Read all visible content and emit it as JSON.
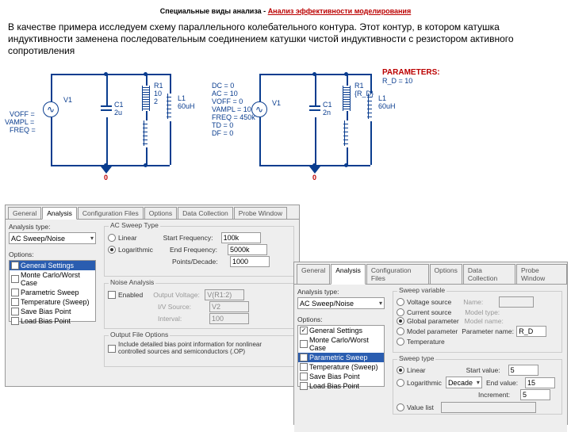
{
  "title_black": "Специальные виды анализа - ",
  "title_red": "Анализ эффективности моделирования",
  "desc": "В качестве примера исследуем схему параллельного колебательного контура. Этот контур, в котором катушка индуктивности заменена последовательным соединением катушки чистой индуктивности с резистором активного сопротивления",
  "sch1": {
    "v1": "V1",
    "voff": "VOFF =",
    "vampl": "VAMPL =",
    "freq": "FREQ =",
    "c1": "C1",
    "c1v": "2u",
    "r1": "R1",
    "r1v": "10",
    "r1v2": "2",
    "l1": "L1",
    "l1v": "60uH",
    "gnd": "0"
  },
  "sch2": {
    "v1": "V1",
    "dc": "DC = 0",
    "ac": "AC = 10",
    "voff": "VOFF = 0",
    "vampl": "VAMPL = 10",
    "freq": "FREQ = 450k",
    "td": "TD = 0",
    "df": "DF = 0",
    "c1": "C1",
    "c1v": "2n",
    "r1": "R1",
    "r1v": "{R_D}",
    "l1": "L1",
    "l1v": "60uH",
    "gnd": "0",
    "param": "PARAMETERS:",
    "param2": "R_D = 10"
  },
  "p1": {
    "tabs": [
      "General",
      "Analysis",
      "Configuration Files",
      "Options",
      "Data Collection",
      "Probe Window"
    ],
    "atype_lbl": "Analysis type:",
    "atype": "AC Sweep/Noise",
    "opt_lbl": "Options:",
    "opts": [
      "General Settings",
      "Monte Carlo/Worst Case",
      "Parametric Sweep",
      "Temperature (Sweep)",
      "Save Bias Point",
      "Load Bias Point"
    ],
    "sweep_hdr": "AC Sweep Type",
    "linear": "Linear",
    "log": "Logarithmic",
    "sf_lbl": "Start Frequency:",
    "sf": "100k",
    "ef_lbl": "End Frequency:",
    "ef": "5000k",
    "pd_lbl": "Points/Decade:",
    "pd": "1000",
    "noise_hdr": "Noise Analysis",
    "enabled": "Enabled",
    "ov_lbl": "Output Voltage:",
    "ov": "V(R1:2)",
    "iv_lbl": "I/V Source:",
    "iv": "V2",
    "int_lbl": "Interval:",
    "int": "100",
    "ofo_hdr": "Output File Options",
    "ofo": "Include detailed bias point information for nonlinear controlled sources and semiconductors (.OP)"
  },
  "p2": {
    "tabs": [
      "General",
      "Analysis",
      "Configuration Files",
      "Options",
      "Data Collection",
      "Probe Window"
    ],
    "atype_lbl": "Analysis type:",
    "atype": "AC Sweep/Noise",
    "opt_lbl": "Options:",
    "opts": [
      "General Settings",
      "Monte Carlo/Worst Case",
      "Parametric Sweep",
      "Temperature (Sweep)",
      "Save Bias Point",
      "Load Bias Point"
    ],
    "sv_hdr": "Sweep variable",
    "vs": "Voltage source",
    "cs": "Current source",
    "gp": "Global parameter",
    "mp": "Model parameter",
    "tmp": "Temperature",
    "name_lbl": "Name:",
    "mtype_lbl": "Model type:",
    "mname_lbl": "Model name:",
    "pname_lbl": "Parameter name:",
    "pname": "R_D",
    "st_hdr": "Sweep type",
    "lin": "Linear",
    "log": "Logarithmic",
    "dec": "Decade",
    "vl": "Value list",
    "sv_lbl": "Start value:",
    "sv": "5",
    "ev_lbl": "End value:",
    "ev": "15",
    "inc_lbl": "Increment:",
    "inc": "5"
  }
}
